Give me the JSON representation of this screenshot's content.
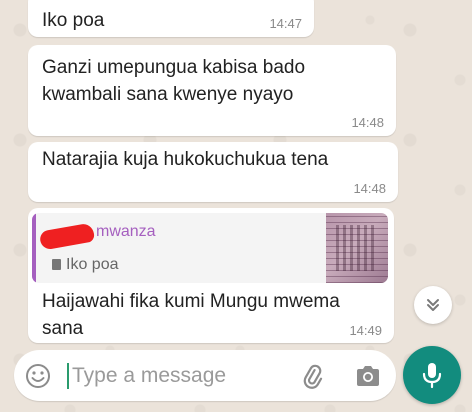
{
  "messages": [
    {
      "text": "Iko poa",
      "time": "14:47"
    },
    {
      "text": "Ganzi umepungua kabisa bado kwambali sana kwenye nyayo",
      "time": "14:48"
    },
    {
      "text": "Natarajia kuja hukokuchukua tena",
      "time": "14:48"
    },
    {
      "quote": {
        "author": "mwanza",
        "text": "Iko poa"
      },
      "text": "Haijawahi fika kumi Mungu mwema sana",
      "time": "14:49"
    }
  ],
  "composer": {
    "placeholder": "Type a message"
  },
  "icons": {
    "scroll": "double-chevron-down-icon",
    "emoji": "emoji-icon",
    "attach": "paperclip-icon",
    "camera": "camera-icon",
    "mic": "microphone-icon"
  },
  "colors": {
    "accent": "#128c7e",
    "quote_author": "#a55fbf",
    "redaction": "#ef2021",
    "chat_background": "#ece5dd"
  }
}
